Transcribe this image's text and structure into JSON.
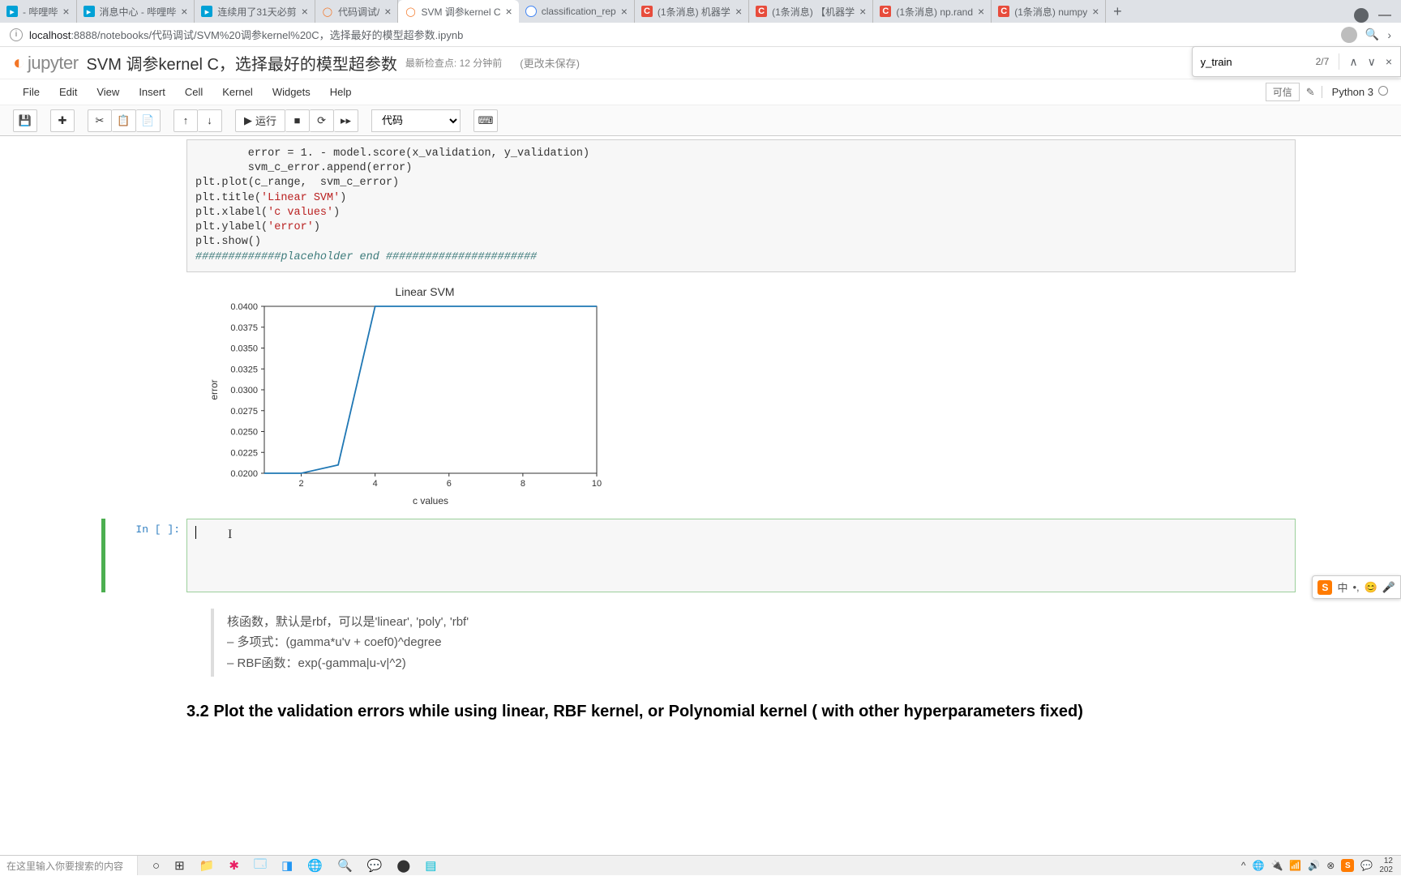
{
  "browser": {
    "tabs": [
      {
        "title": "- 哔哩哔",
        "favicon": "bili"
      },
      {
        "title": "消息中心 - 哔哩哔",
        "favicon": "bili"
      },
      {
        "title": "连续用了31天必剪",
        "favicon": "bili"
      },
      {
        "title": "代码调试/",
        "favicon": "jup"
      },
      {
        "title": "SVM 调参kernel C",
        "favicon": "jup",
        "active": true
      },
      {
        "title": "classification_rep",
        "favicon": "goog"
      },
      {
        "title": "(1条消息) 机器学",
        "favicon": "c"
      },
      {
        "title": "(1条消息) 【机器学",
        "favicon": "c"
      },
      {
        "title": "(1条消息) np.rand",
        "favicon": "c"
      },
      {
        "title": "(1条消息) numpy",
        "favicon": "c"
      }
    ],
    "url_host": "localhost",
    "url_path": ":8888/notebooks/代码调试/SVM%20调参kernel%20C，选择最好的模型超参数.ipynb",
    "find": {
      "value": "y_train",
      "count": "2/7"
    }
  },
  "jupyter": {
    "logo_text": "jupyter",
    "nb_name": "SVM 调参kernel C，选择最好的模型超参数",
    "checkpoint": "最新检查点: 12 分钟前",
    "autosave": "(更改未保存)",
    "menus": [
      "File",
      "Edit",
      "View",
      "Insert",
      "Cell",
      "Kernel",
      "Widgets",
      "Help"
    ],
    "trusted": "可信",
    "kernel": "Python 3",
    "run_label": "运行",
    "cell_type": "代码"
  },
  "code": {
    "line1": "        error = 1. - model.score(x_validation, y_validation)",
    "line2": "        svm_c_error.append(error)",
    "line3a": "plt.plot(c_range,  svm_c_error)",
    "line4a": "plt.title(",
    "line4b": "'Linear SVM'",
    "line4c": ")",
    "line5a": "plt.xlabel(",
    "line5b": "'c values'",
    "line5c": ")",
    "line6a": "plt.ylabel(",
    "line6b": "'error'",
    "line6c": ")",
    "line7": "plt.show()",
    "line8": "#############placeholder end #######################"
  },
  "prompt_empty": "In [ ]:",
  "blockquote": {
    "l1": "核函数，默认是rbf，可以是'linear', 'poly', 'rbf'",
    "l2": "– 多项式：(gamma*u'v + coef0)^degree",
    "l3": "– RBF函数：exp(-gamma|u-v|^2)"
  },
  "heading": "3.2 Plot the validation errors while using linear, RBF kernel, or Polynomial kernel ( with other hyperparameters fixed)",
  "chart_data": {
    "type": "line",
    "title": "Linear SVM",
    "xlabel": "c values",
    "ylabel": "error",
    "x": [
      1,
      2,
      3,
      4,
      5,
      6,
      7,
      8,
      9,
      10
    ],
    "values": [
      0.02,
      0.02,
      0.021,
      0.04,
      0.04,
      0.04,
      0.04,
      0.04,
      0.04,
      0.04
    ],
    "ylim": [
      0.02,
      0.04
    ],
    "xlim": [
      1,
      10
    ],
    "yticks": [
      0.02,
      0.0225,
      0.025,
      0.0275,
      0.03,
      0.0325,
      0.035,
      0.0375,
      0.04
    ],
    "xticks": [
      2,
      4,
      6,
      8,
      10
    ]
  },
  "taskbar": {
    "search_placeholder": "在这里输入你要搜索的内容",
    "time1": "12",
    "time2": "202"
  },
  "sogou": {
    "lang": "中"
  }
}
